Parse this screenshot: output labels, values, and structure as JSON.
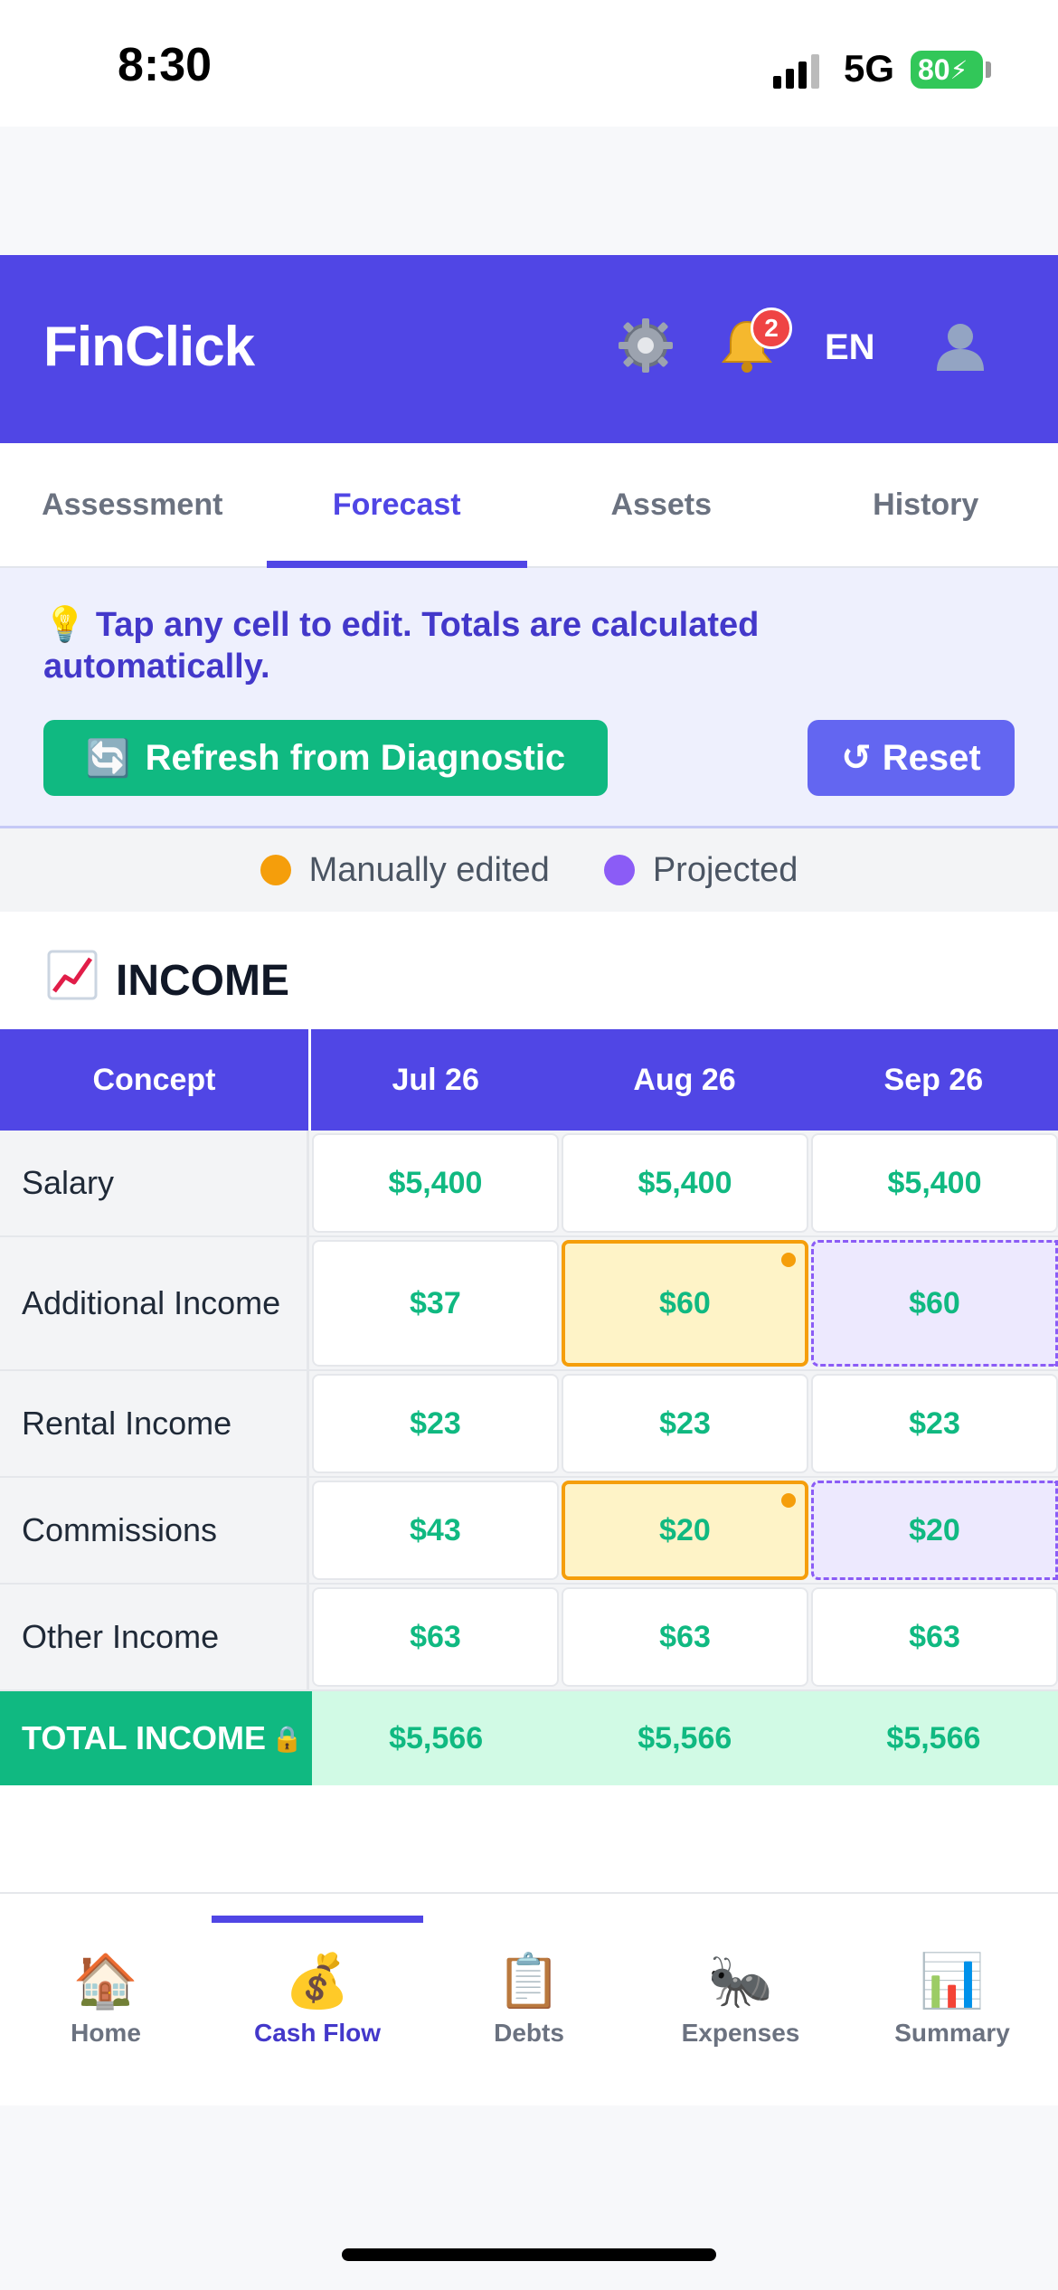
{
  "status_bar": {
    "time": "8:30",
    "network": "5G",
    "battery": "80"
  },
  "header": {
    "title": "FinClick",
    "notifications": "2",
    "language": "EN"
  },
  "tabs": [
    {
      "label": "Assessment",
      "active": false
    },
    {
      "label": "Forecast",
      "active": true
    },
    {
      "label": "Assets",
      "active": false
    },
    {
      "label": "History",
      "active": false
    }
  ],
  "info": {
    "hint": "Tap any cell to edit. Totals are calculated automatically.",
    "refresh_label": "Refresh from Diagnostic",
    "reset_label": "Reset"
  },
  "legend": {
    "edited": "Manually edited",
    "projected": "Projected"
  },
  "section": {
    "title": "INCOME"
  },
  "table": {
    "concept_header": "Concept",
    "months": [
      "Jul 26",
      "Aug 26",
      "Sep 26"
    ],
    "rows": [
      {
        "label": "Salary",
        "values": [
          "$5,400",
          "$5,400",
          "$5,400"
        ],
        "states": [
          "",
          "",
          ""
        ]
      },
      {
        "label": "Additional Income",
        "values": [
          "$37",
          "$60",
          "$60"
        ],
        "states": [
          "",
          "edited",
          "projected"
        ]
      },
      {
        "label": "Rental Income",
        "values": [
          "$23",
          "$23",
          "$23"
        ],
        "states": [
          "",
          "",
          ""
        ]
      },
      {
        "label": "Commissions",
        "values": [
          "$43",
          "$20",
          "$20"
        ],
        "states": [
          "",
          "edited",
          "projected"
        ]
      },
      {
        "label": "Other Income",
        "values": [
          "$63",
          "$63",
          "$63"
        ],
        "states": [
          "",
          "",
          ""
        ]
      }
    ],
    "total": {
      "label": "TOTAL INCOME",
      "values": [
        "$5,566",
        "$5,566",
        "$5,566"
      ]
    }
  },
  "bottom_nav": [
    {
      "label": "Home",
      "icon": "house-icon",
      "emoji": "🏠",
      "active": false
    },
    {
      "label": "Cash Flow",
      "icon": "money-bag-icon",
      "emoji": "💰",
      "active": true
    },
    {
      "label": "Debts",
      "icon": "clipboard-icon",
      "emoji": "📋",
      "active": false
    },
    {
      "label": "Expenses",
      "icon": "ant-icon",
      "emoji": "🐜",
      "active": false
    },
    {
      "label": "Summary",
      "icon": "bar-chart-icon",
      "emoji": "📊",
      "active": false
    }
  ],
  "colors": {
    "primary": "#5046e5",
    "success": "#10b981",
    "edited": "#f59e0b",
    "projected": "#8b5cf6"
  }
}
